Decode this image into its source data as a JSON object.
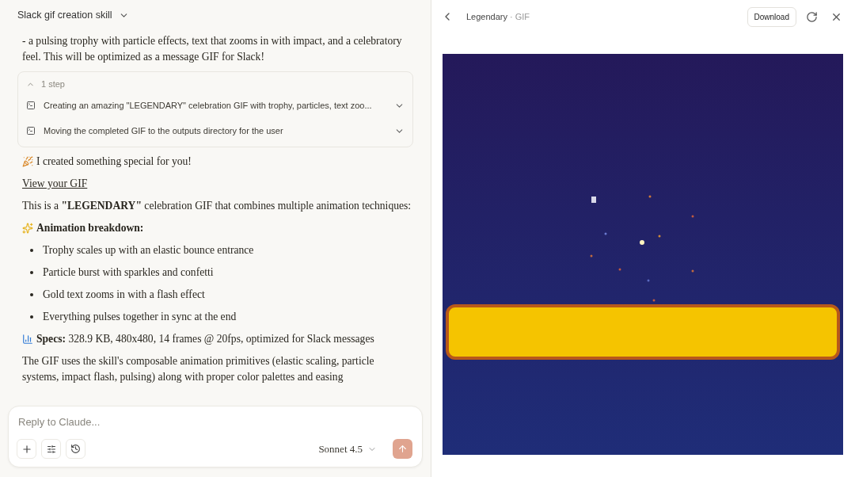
{
  "chat": {
    "title": "Slack gif creation skill",
    "intro": "- a pulsing trophy with particle effects, text that zooms in with impact, and a celebratory feel. This will be optimized as a message GIF for Slack!",
    "steps": {
      "label": "1 step",
      "expanded": true,
      "items": [
        {
          "text": "Creating an amazing \"LEGENDARY\" celebration GIF with trophy, particles, text zoo..."
        },
        {
          "text": "Moving the completed GIF to the outputs directory for the user"
        }
      ]
    },
    "blocks": [
      {
        "kind": "party",
        "text": "I created something special for you!"
      },
      {
        "kind": "link",
        "text": "View your GIF"
      },
      {
        "kind": "para",
        "text": "This is a **\"LEGENDARY\"** celebration GIF that combines multiple animation techniques:"
      },
      {
        "kind": "sparkle",
        "text": "Animation breakdown:"
      },
      {
        "kind": "bullet",
        "text": "Trophy scales up with an elastic bounce entrance"
      },
      {
        "kind": "bullet",
        "text": "Particle burst with sparkles and confetti"
      },
      {
        "kind": "bullet",
        "text": "Gold text zooms in with a flash effect"
      },
      {
        "kind": "bullet",
        "text": "Everything pulses together in sync at the end"
      },
      {
        "kind": "chart",
        "text": "**Specs:** 328.9 KB, 480x480, 14 frames @ 20fps, optimized for Slack messages"
      },
      {
        "kind": "para",
        "text": "The GIF uses the skill's composable animation primitives (elastic scaling, particle systems, impact flash, pulsing) along with proper color palettes and easing"
      }
    ]
  },
  "composer": {
    "placeholder": "Reply to Claude...",
    "model": "Sonnet 4.5"
  },
  "preview": {
    "title": "Legendary",
    "type": "· GIF",
    "download": "Download"
  }
}
